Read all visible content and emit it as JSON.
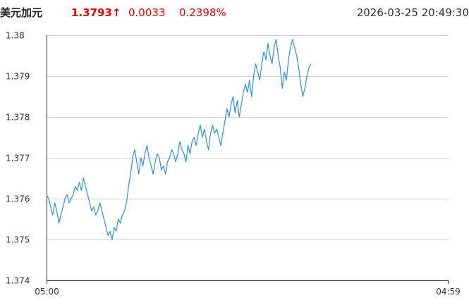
{
  "header": {
    "pair_name": "美元加元",
    "last_price": "1.3793↑",
    "change_abs": "0.0033",
    "change_pct": "0.2398%",
    "timestamp": "2026-03-25 20:49:30",
    "up_color": "#e60000"
  },
  "chart_data": {
    "type": "line",
    "title": "",
    "xlabel": "",
    "ylabel": "",
    "x_tick_labels": [
      "05:00",
      "04:59"
    ],
    "x_session": [
      "05:00",
      "04:59"
    ],
    "y_ticks": [
      1.374,
      1.375,
      1.376,
      1.377,
      1.378,
      1.379,
      1.38
    ],
    "ylim": [
      1.374,
      1.38
    ],
    "grid": "horizontal",
    "line_color": "#2f8fe0",
    "series": [
      {
        "values": [
          1.3761,
          1.376,
          1.3758,
          1.3756,
          1.3759,
          1.3757,
          1.3754,
          1.3756,
          1.3758,
          1.376,
          1.3761,
          1.3759,
          1.376,
          1.3761,
          1.3763,
          1.3762,
          1.3764,
          1.3762,
          1.3765,
          1.3763,
          1.3761,
          1.3759,
          1.3757,
          1.3758,
          1.3756,
          1.3757,
          1.3759,
          1.3757,
          1.3755,
          1.3753,
          1.3751,
          1.3752,
          1.375,
          1.3753,
          1.3752,
          1.3755,
          1.3754,
          1.3756,
          1.3757,
          1.3759,
          1.3763,
          1.3766,
          1.377,
          1.3772,
          1.3769,
          1.3766,
          1.377,
          1.3768,
          1.3771,
          1.3773,
          1.377,
          1.3768,
          1.3766,
          1.3769,
          1.3771,
          1.377,
          1.3767,
          1.3768,
          1.3766,
          1.3769,
          1.377,
          1.3772,
          1.3771,
          1.3769,
          1.3771,
          1.3774,
          1.3772,
          1.3771,
          1.3769,
          1.3773,
          1.3771,
          1.3774,
          1.3775,
          1.3773,
          1.3776,
          1.3778,
          1.3775,
          1.3777,
          1.3774,
          1.3772,
          1.3776,
          1.3778,
          1.3776,
          1.3777,
          1.3775,
          1.3773,
          1.3776,
          1.3779,
          1.3782,
          1.378,
          1.3783,
          1.3785,
          1.3781,
          1.3784,
          1.378,
          1.3783,
          1.3786,
          1.3788,
          1.3786,
          1.3789,
          1.3785,
          1.379,
          1.3793,
          1.3791,
          1.3789,
          1.3793,
          1.3796,
          1.3794,
          1.3798,
          1.3795,
          1.3793,
          1.3797,
          1.3799,
          1.3795,
          1.3792,
          1.3787,
          1.3791,
          1.3789,
          1.3794,
          1.3797,
          1.3799,
          1.3797,
          1.3795,
          1.3792,
          1.3788,
          1.3785,
          1.3787,
          1.379,
          1.3792,
          1.3793
        ]
      }
    ]
  }
}
